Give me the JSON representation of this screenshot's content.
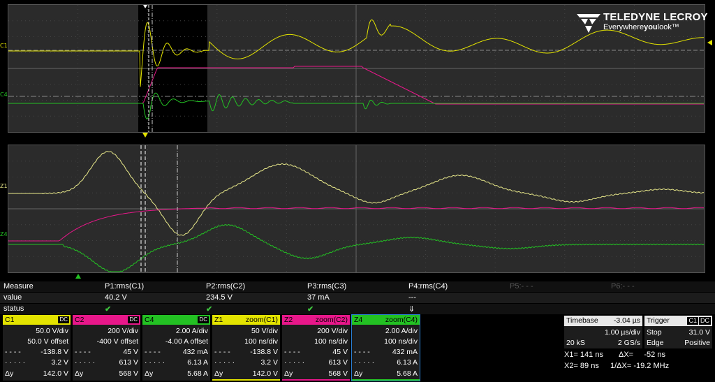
{
  "brand": {
    "name": "TELEDYNE LECROY",
    "tag_pre": "Everywhere",
    "tag_bold": "you",
    "tag_post": "look"
  },
  "colors": {
    "c1": "#e3e300",
    "c2": "#e8178a",
    "c4": "#23c123",
    "z1": "#e8e88a"
  },
  "upper_labels": {
    "c1": "C1",
    "c4": "C4"
  },
  "lower_labels": {
    "z1": "Z1",
    "z4": "Z4"
  },
  "measure": {
    "headers": [
      "Measure",
      "P1:rms(C1)",
      "P2:rms(C2)",
      "P3:rms(C3)",
      "P4:rms(C4)",
      "P5:- - -",
      "P6:- - -"
    ],
    "values": [
      "value",
      "40.2 V",
      "234.5 V",
      "37 mA",
      "---"
    ],
    "status": "status",
    "p4_status_icon": "⇓"
  },
  "channels": [
    {
      "name": "C1",
      "coupling": "DC",
      "vdiv": "50.0 V/div",
      "offset": "50.0 V offset",
      "r1l": "- - - -",
      "r1": "-138.8 V",
      "r2l": "· · · · ·",
      "r2": "3.2 V",
      "r3l": "Δy",
      "r3": "142.0 V"
    },
    {
      "name": "C2",
      "coupling": "DC",
      "vdiv": "200 V/div",
      "offset": "-400 V offset",
      "r1l": "- - - -",
      "r1": "45 V",
      "r2l": "· · · · ·",
      "r2": "613 V",
      "r3l": "Δy",
      "r3": "568 V"
    },
    {
      "name": "C4",
      "coupling": "DC",
      "vdiv": "2.00 A/div",
      "offset": "-4.00 A offset",
      "r1l": "- - - -",
      "r1": "432 mA",
      "r2l": "· · · · ·",
      "r2": "6.13 A",
      "r3l": "Δy",
      "r3": "5.68 A"
    },
    {
      "name": "Z1",
      "caption": "zoom(C1)",
      "vdiv": "50 V/div",
      "offset": "100 ns/div",
      "r1l": "- - - -",
      "r1": "-138.8 V",
      "r2l": "· · · · ·",
      "r2": "3.2 V",
      "r3l": "Δy",
      "r3": "142.0 V"
    },
    {
      "name": "Z2",
      "caption": "zoom(C2)",
      "vdiv": "200 V/div",
      "offset": "100 ns/div",
      "r1l": "- - - -",
      "r1": "45 V",
      "r2l": "· · · · ·",
      "r2": "613 V",
      "r3l": "Δy",
      "r3": "568 V"
    },
    {
      "name": "Z4",
      "caption": "zoom(C4)",
      "vdiv": "2.00 A/div",
      "offset": "100 ns/div",
      "r1l": "- - - -",
      "r1": "432 mA",
      "r2l": "· · · · ·",
      "r2": "6.13 A",
      "r3l": "Δy",
      "r3": "5.68 A"
    }
  ],
  "timebase": {
    "label": "Timebase",
    "value": "-3.04 µs",
    "per_div": "1.00 µs/div",
    "samples": "20 kS",
    "rate": "2 GS/s"
  },
  "trigger": {
    "label": "Trigger",
    "source": "C1",
    "coupling": "DC",
    "mode": "Stop",
    "level": "31.0 V",
    "type": "Edge",
    "slope": "Positive"
  },
  "cursors": {
    "x1": "X1= 141 ns",
    "dx": "ΔX=     -52 ns",
    "x2": "X2= 89 ns",
    "inv_dx": "1/ΔX= -19.2 MHz"
  }
}
